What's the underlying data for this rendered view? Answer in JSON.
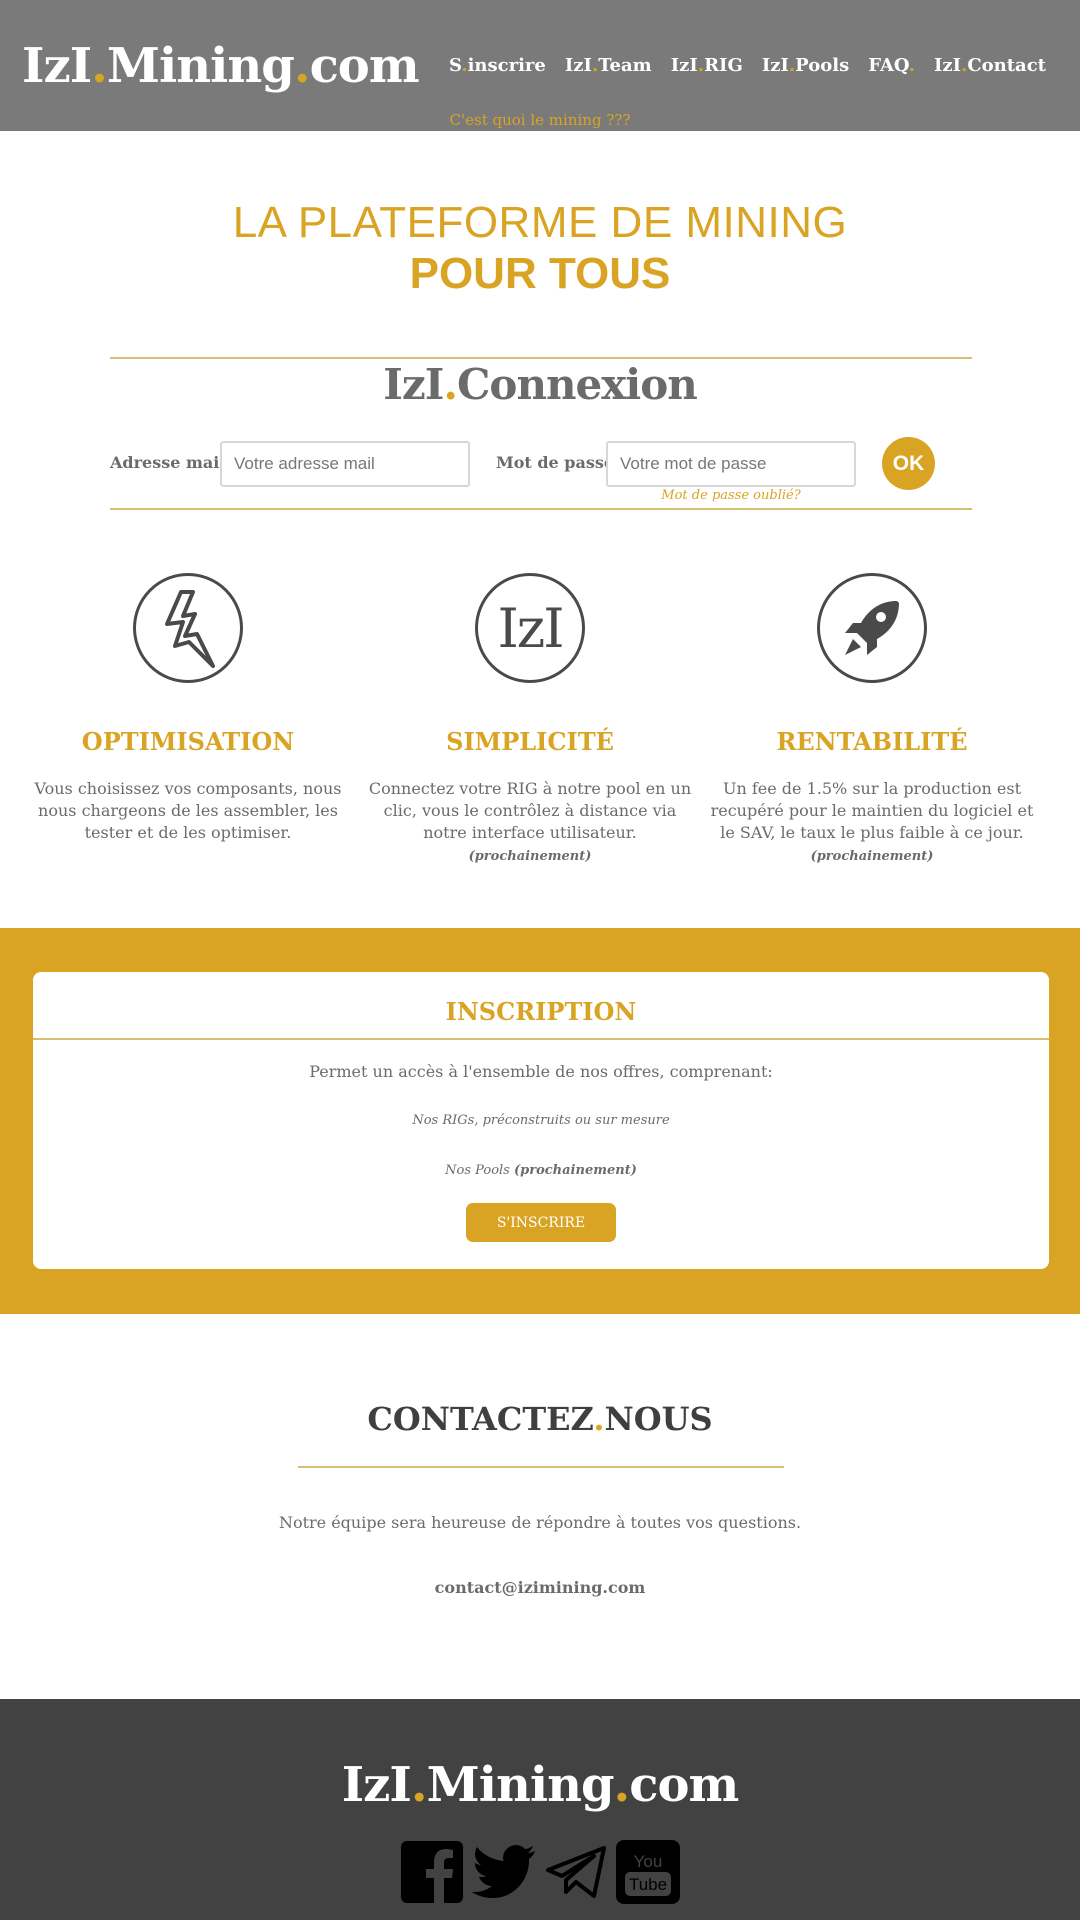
{
  "header": {
    "logo": {
      "part1": "IzI",
      "dot1": ".",
      "part2": "Mining",
      "dot2": ".",
      "part3": "com"
    },
    "nav": [
      {
        "a": "S",
        "dot": ".",
        "b": "inscrire"
      },
      {
        "a": "IzI",
        "dot": ".",
        "b": "Team"
      },
      {
        "a": "IzI",
        "dot": ".",
        "b": "RIG"
      },
      {
        "a": "IzI",
        "dot": ".",
        "b": "Pools"
      },
      {
        "a": "FAQ",
        "dot": ".",
        "b": ""
      },
      {
        "a": "IzI",
        "dot": ".",
        "b": "Contact"
      }
    ],
    "sublink": "C'est quoi le mining ???"
  },
  "hero": {
    "line1": "LA PLATEFORME DE MINING",
    "line2": "POUR TOUS"
  },
  "login": {
    "title_a": "IzI",
    "title_dot": ".",
    "title_b": "Connexion",
    "email_label": "Adresse mail",
    "email_placeholder": "Votre adresse mail",
    "password_label": "Mot de passe",
    "password_placeholder": "Votre mot de passe",
    "ok_label": "OK",
    "forgot": "Mot de passe oublié?"
  },
  "features": [
    {
      "icon": "lightning-icon",
      "title": "OPTIMISATION",
      "text": "Vous choisissez vos composants, nous nous chargeons de les assembler, les tester et de les optimiser.",
      "note": ""
    },
    {
      "icon": "izi-logo-icon",
      "icon_text": "IzI",
      "title": "SIMPLICITÉ",
      "text": "Connectez votre RIG à notre pool en un clic, vous le contrôlez à distance via notre interface utilisateur.",
      "note": "(prochainement)"
    },
    {
      "icon": "rocket-icon",
      "title": "RENTABILITÉ",
      "text": "Un fee de 1.5% sur la production est recupéré pour le maintien du logiciel et le SAV, le taux le plus faible à ce jour.",
      "note": "(prochainement)"
    }
  ],
  "inscription": {
    "title": "INSCRIPTION",
    "intro": "Permet un accès à l'ensemble de nos offres, comprenant:",
    "item1": "Nos RIGs, préconstruits ou sur mesure",
    "item2": "Nos Pools",
    "item2_note": "(prochainement)",
    "button": "S'INSCRIRE"
  },
  "contact": {
    "title_a": "CONTACTEZ",
    "title_dot": ".",
    "title_b": "NOUS",
    "text": "Notre équipe sera heureuse de répondre à toutes vos questions.",
    "email": "contact@izimining.com"
  },
  "footer": {
    "logo": {
      "part1": "IzI",
      "dot1": ".",
      "part2": "Mining",
      "dot2": ".",
      "part3": "com"
    },
    "socials": [
      "facebook-icon",
      "twitter-icon",
      "telegram-icon",
      "youtube-icon"
    ]
  },
  "colors": {
    "accent": "#d9a423",
    "header_bg": "#7a7a7a",
    "footer_bg": "#424242"
  }
}
